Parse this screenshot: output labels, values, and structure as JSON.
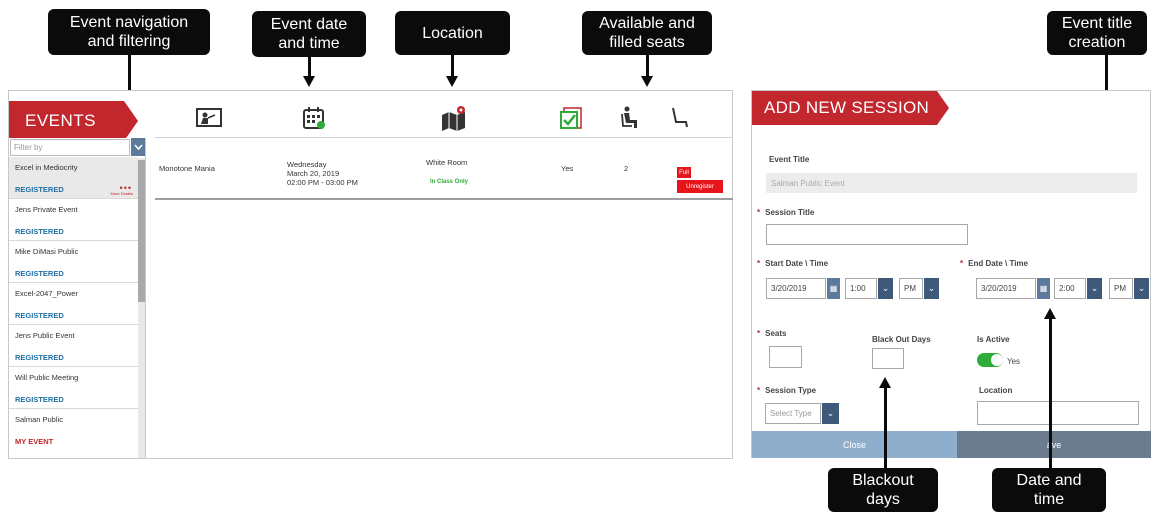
{
  "callouts": {
    "event_nav": "Event navigation\nand filtering",
    "event_date": "Event date\nand time",
    "location": "Location",
    "seats": "Available and\nfilled seats",
    "event_title": "Event title\ncreation",
    "blackout": "Blackout\ndays",
    "date_time": "Date and\ntime"
  },
  "events_panel": {
    "title": "EVENTS",
    "filter_placeholder": "Filter by",
    "header_icons": [
      "person-board-icon",
      "calendar-icon",
      "map-pin-icon",
      "checklist-icon",
      "seated-person-icon",
      "empty-seat-icon"
    ],
    "list": [
      {
        "name": "Excel in Mediocrity",
        "status": "REGISTERED",
        "selected": true,
        "more": "More Details"
      },
      {
        "name": "Jens Private Event",
        "status": "REGISTERED"
      },
      {
        "name": "Mike DiMasi Public",
        "status": "REGISTERED"
      },
      {
        "name": "Excel-2047_Power",
        "status": "REGISTERED"
      },
      {
        "name": "Jens Public Event",
        "status": "REGISTERED"
      },
      {
        "name": "Will Public Meeting",
        "status": "REGISTERED"
      },
      {
        "name": "Salman Public",
        "status": "MY EVENT"
      }
    ],
    "row": {
      "event": "Monotone Mania",
      "day": "Wednesday",
      "date": "March 20, 2019",
      "time": "02:00 PM - 03:00 PM",
      "location": "White Room",
      "location_note": "In Class Only",
      "available": "Yes",
      "filled": "2",
      "full_label": "Full",
      "unregister_label": "Unregister"
    }
  },
  "session_panel": {
    "title": "ADD NEW SESSION",
    "event_title_label": "Event Title",
    "event_title_value": "Salman Public Event",
    "session_title_label": "Session Title",
    "start_label": "Start Date \\ Time",
    "start_date": "3/20/2019",
    "start_time": "1:00",
    "start_ampm": "PM",
    "end_label": "End Date \\ Time",
    "end_date": "3/20/2019",
    "end_time": "2:00",
    "end_ampm": "PM",
    "seats_label": "Seats",
    "blackout_label": "Black Out Days",
    "active_label": "Is Active",
    "active_value": "Yes",
    "session_type_label": "Session Type",
    "session_type_placeholder": "Select Type",
    "location_label": "Location",
    "close_label": "Close",
    "save_label": "ave"
  },
  "colors": {
    "brand_red": "#c1272d",
    "steel_blue": "#5b7a9c",
    "toggle_green": "#2eab39"
  }
}
